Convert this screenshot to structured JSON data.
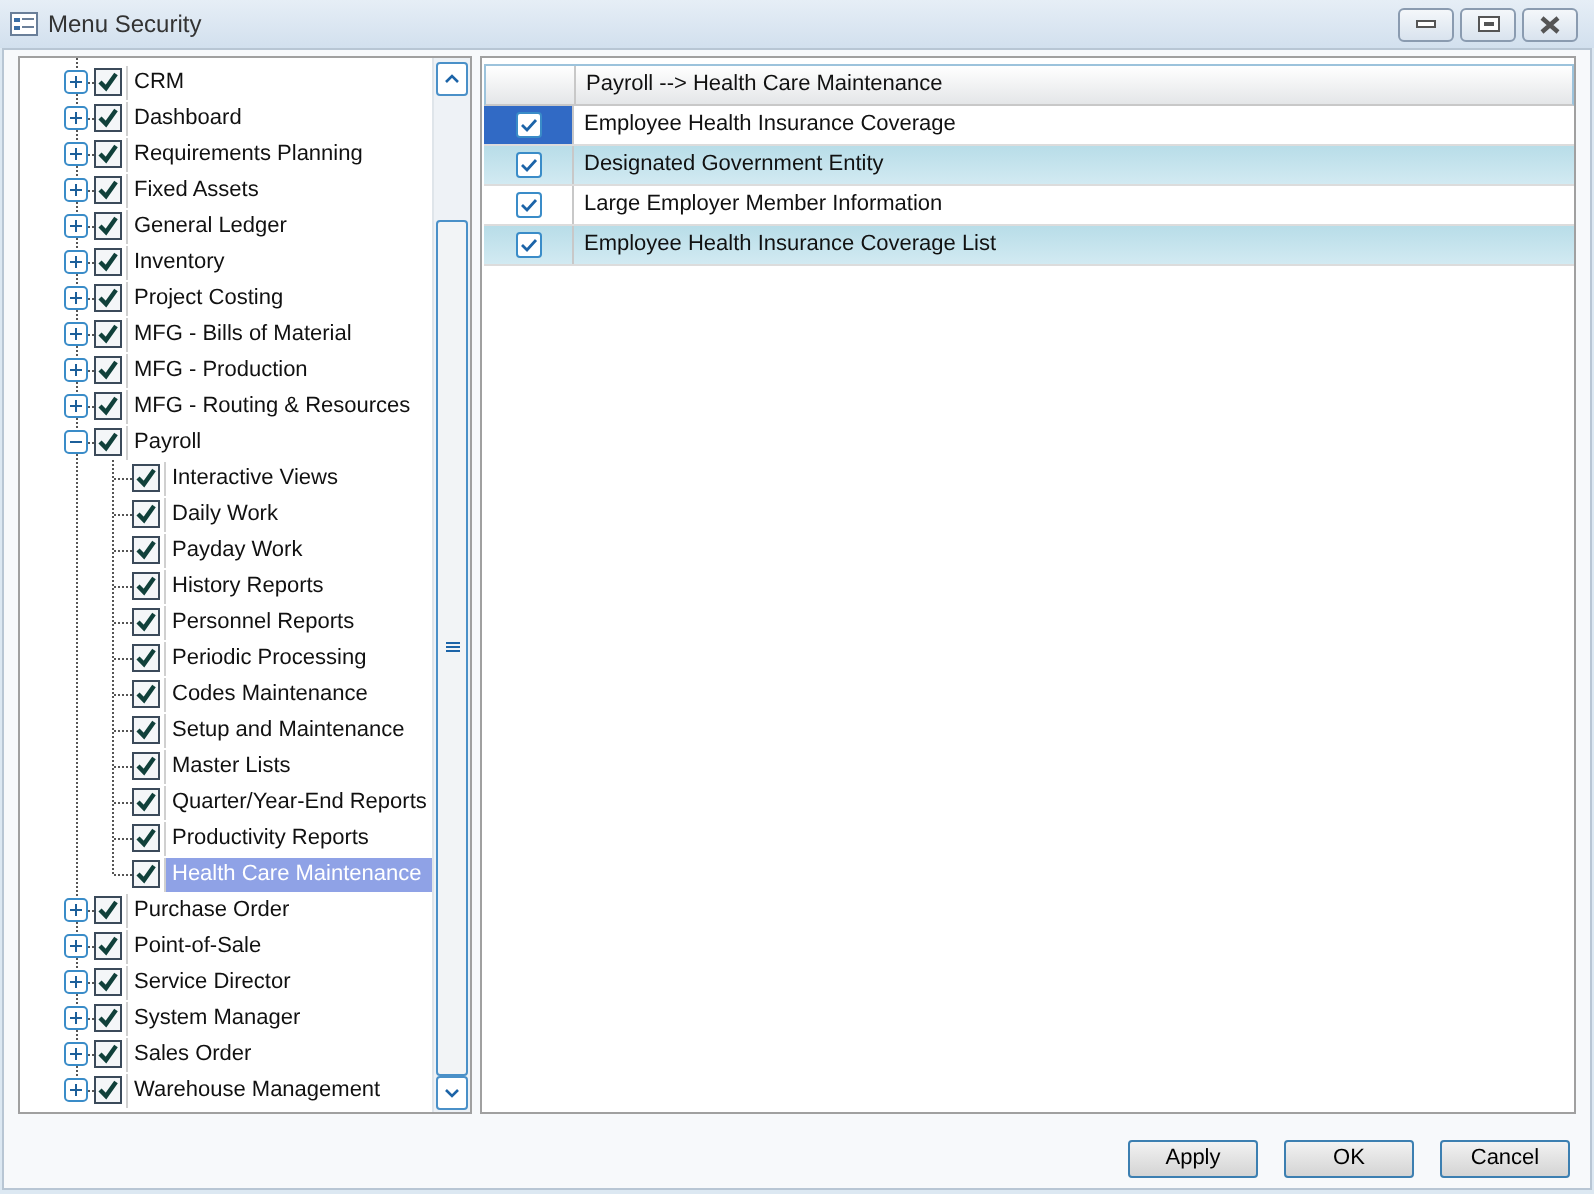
{
  "window": {
    "title": "Menu Security"
  },
  "tree": [
    {
      "label": "CRM",
      "checked": true,
      "expanded": false,
      "selected": false
    },
    {
      "label": "Dashboard",
      "checked": true,
      "expanded": false,
      "selected": false
    },
    {
      "label": "Requirements Planning",
      "checked": true,
      "expanded": false,
      "selected": false
    },
    {
      "label": "Fixed Assets",
      "checked": true,
      "expanded": false,
      "selected": false
    },
    {
      "label": "General Ledger",
      "checked": true,
      "expanded": false,
      "selected": false
    },
    {
      "label": "Inventory",
      "checked": true,
      "expanded": false,
      "selected": false
    },
    {
      "label": "Project Costing",
      "checked": true,
      "expanded": false,
      "selected": false
    },
    {
      "label": "MFG - Bills of Material",
      "checked": true,
      "expanded": false,
      "selected": false
    },
    {
      "label": "MFG - Production",
      "checked": true,
      "expanded": false,
      "selected": false
    },
    {
      "label": "MFG - Routing & Resources",
      "checked": true,
      "expanded": false,
      "selected": false
    },
    {
      "label": "Payroll",
      "checked": true,
      "expanded": true,
      "selected": false,
      "children": [
        {
          "label": "Interactive Views",
          "checked": true,
          "selected": false
        },
        {
          "label": "Daily Work",
          "checked": true,
          "selected": false
        },
        {
          "label": "Payday Work",
          "checked": true,
          "selected": false
        },
        {
          "label": "History Reports",
          "checked": true,
          "selected": false
        },
        {
          "label": "Personnel Reports",
          "checked": true,
          "selected": false
        },
        {
          "label": "Periodic Processing",
          "checked": true,
          "selected": false
        },
        {
          "label": "Codes Maintenance",
          "checked": true,
          "selected": false
        },
        {
          "label": "Setup and Maintenance",
          "checked": true,
          "selected": false
        },
        {
          "label": "Master Lists",
          "checked": true,
          "selected": false
        },
        {
          "label": "Quarter/Year-End Reports",
          "checked": true,
          "selected": false
        },
        {
          "label": "Productivity Reports",
          "checked": true,
          "selected": false
        },
        {
          "label": "Health Care Maintenance",
          "checked": true,
          "selected": true
        }
      ]
    },
    {
      "label": "Purchase Order",
      "checked": true,
      "expanded": false,
      "selected": false
    },
    {
      "label": "Point-of-Sale",
      "checked": true,
      "expanded": false,
      "selected": false
    },
    {
      "label": "Service Director",
      "checked": true,
      "expanded": false,
      "selected": false
    },
    {
      "label": "System Manager",
      "checked": true,
      "expanded": false,
      "selected": false
    },
    {
      "label": "Sales Order",
      "checked": true,
      "expanded": false,
      "selected": false
    },
    {
      "label": "Warehouse Management",
      "checked": true,
      "expanded": false,
      "selected": false
    }
  ],
  "grid": {
    "header": "Payroll  -->  Health Care Maintenance",
    "rows": [
      {
        "label": "Employee Health Insurance Coverage",
        "checked": true,
        "selected": true
      },
      {
        "label": "Designated Government Entity",
        "checked": true,
        "selected": false
      },
      {
        "label": "Large Employer Member Information",
        "checked": true,
        "selected": false
      },
      {
        "label": "Employee Health Insurance Coverage List",
        "checked": true,
        "selected": false
      }
    ]
  },
  "buttons": [
    "Apply",
    "OK",
    "Cancel"
  ]
}
